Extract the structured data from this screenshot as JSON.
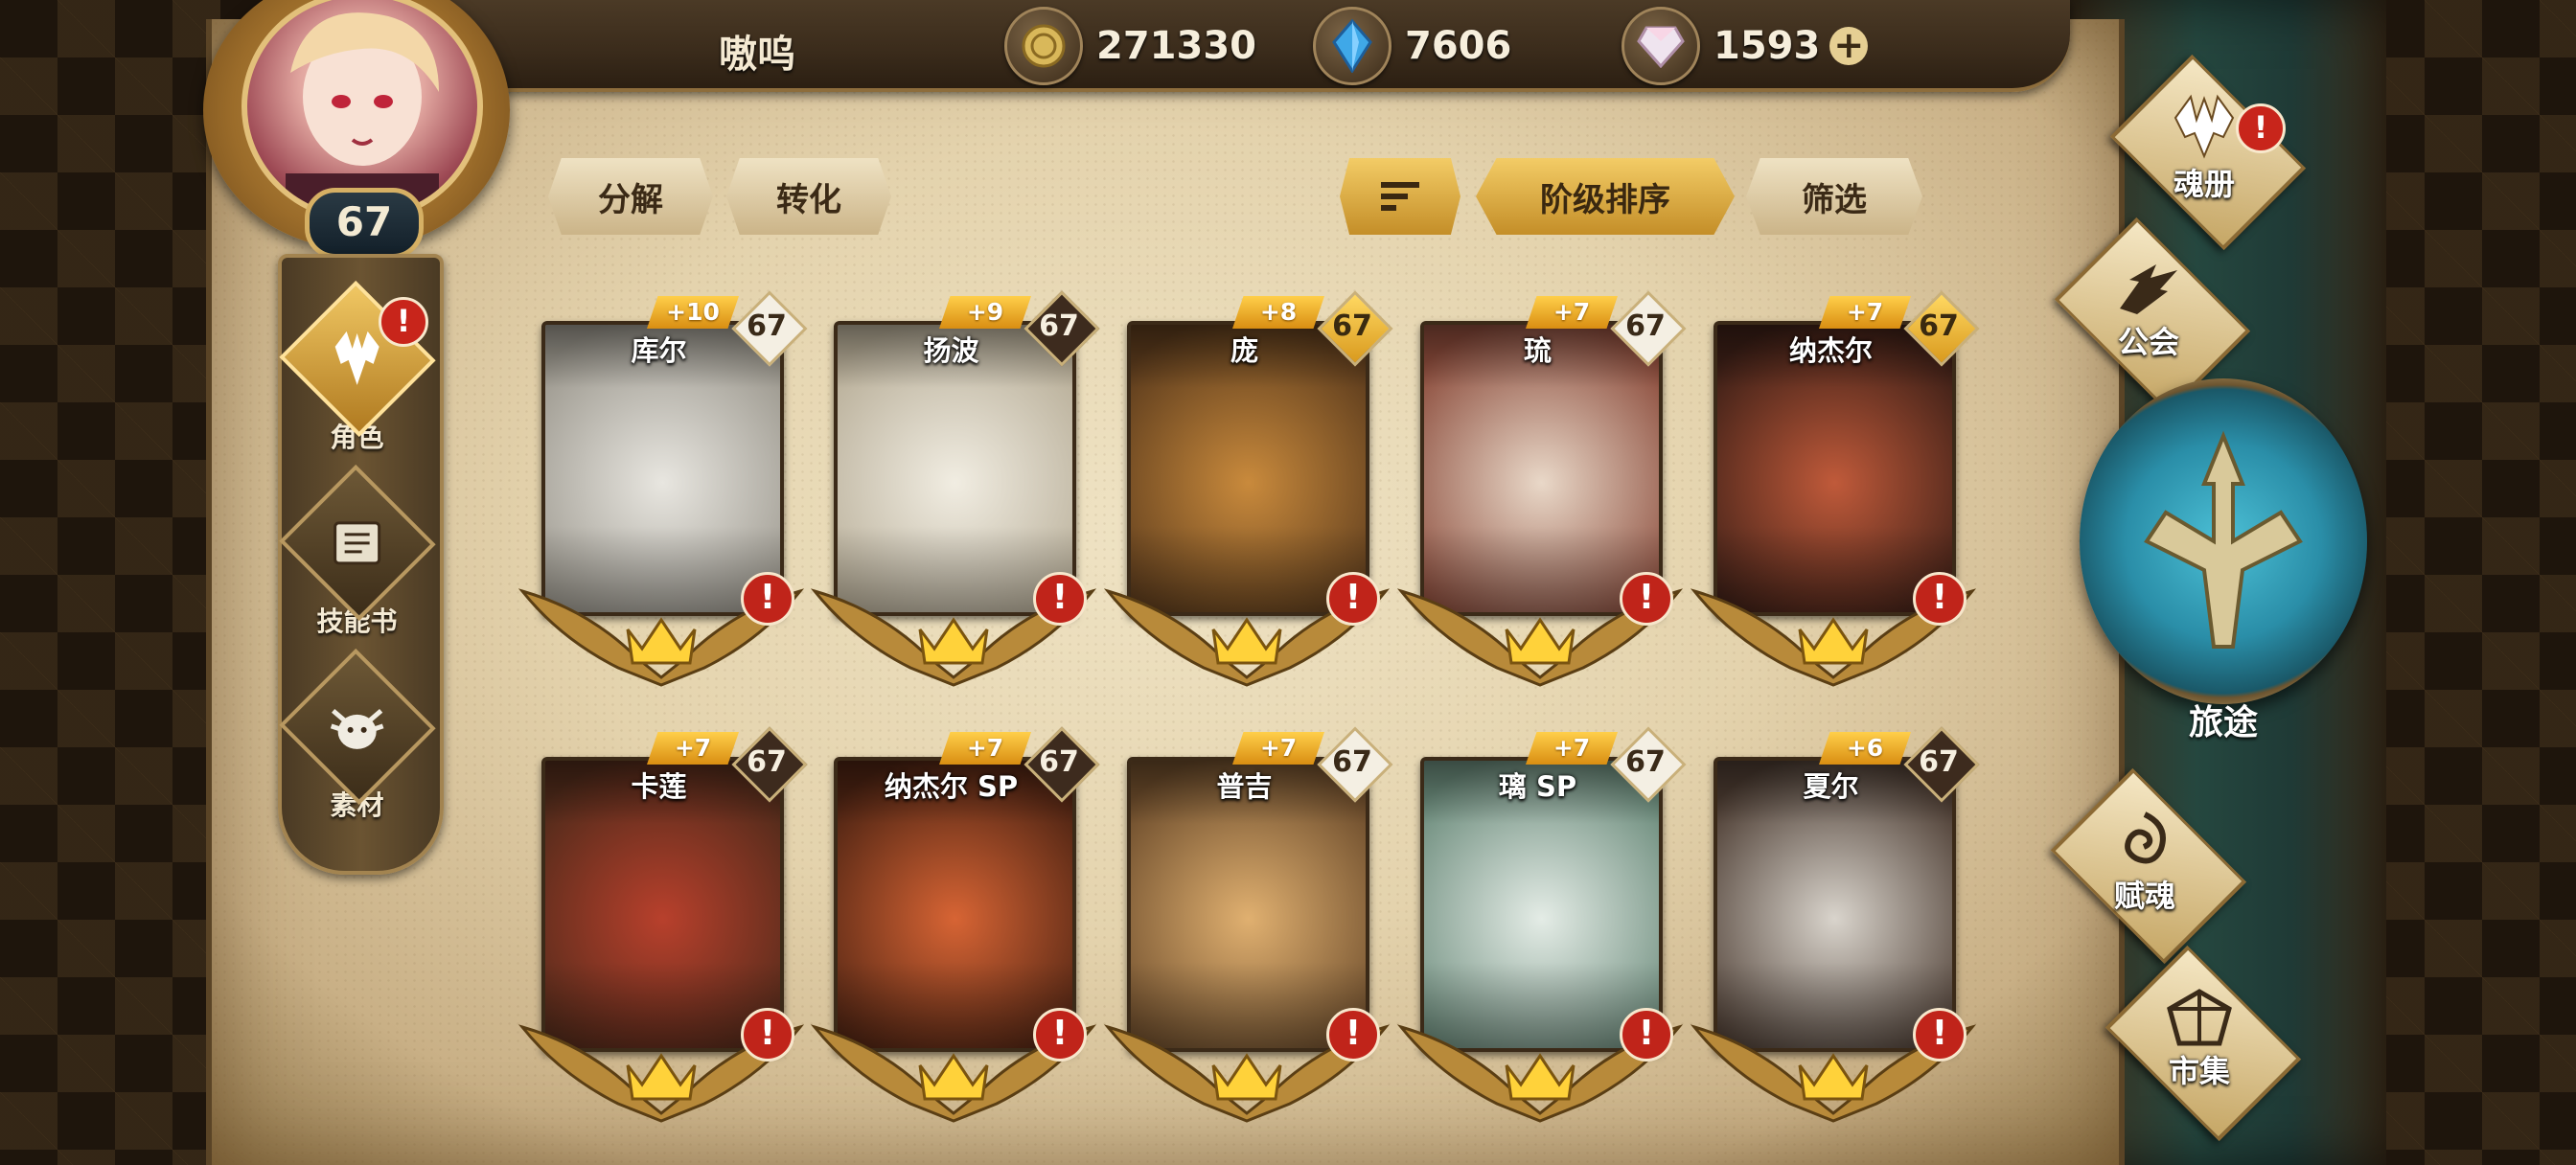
{
  "player": {
    "name": "嗷呜",
    "level": "67"
  },
  "resources": [
    {
      "name": "gold",
      "value": "271330",
      "color": "#e0c16a"
    },
    {
      "name": "crystal",
      "value": "7606",
      "color": "#3fa8e8"
    },
    {
      "name": "gem",
      "value": "1593",
      "color": "#e6d9e6"
    }
  ],
  "left_nav": [
    {
      "label": "角色",
      "icon": "character-icon",
      "active": true,
      "alert": "!"
    },
    {
      "label": "技能书",
      "icon": "skill-book-icon",
      "active": false
    },
    {
      "label": "素材",
      "icon": "material-icon",
      "active": false
    }
  ],
  "actions": {
    "decompose": "分解",
    "convert": "转化",
    "sort_by_tier": "阶级排序",
    "filter": "筛选"
  },
  "cards": [
    {
      "name": "库尔",
      "plus": "+10",
      "level": "67",
      "level_style": "white",
      "art_colors": [
        "#e8e6e0",
        "#9a968c"
      ]
    },
    {
      "name": "扬波",
      "plus": "+9",
      "level": "67",
      "level_style": "dark",
      "art_colors": [
        "#f1ede2",
        "#b7ad97"
      ]
    },
    {
      "name": "庞",
      "plus": "+8",
      "level": "67",
      "level_style": "gold",
      "art_colors": [
        "#c98a3c",
        "#5a3a1c"
      ]
    },
    {
      "name": "琉",
      "plus": "+7",
      "level": "67",
      "level_style": "white",
      "art_colors": [
        "#e9d8c8",
        "#8a4a3a"
      ]
    },
    {
      "name": "纳杰尔",
      "plus": "+7",
      "level": "67",
      "level_style": "gold",
      "art_colors": [
        "#c05a3a",
        "#3a1e16"
      ]
    },
    {
      "name": "卡莲",
      "plus": "+7",
      "level": "67",
      "level_style": "dark",
      "art_colors": [
        "#b8402c",
        "#4e2a1a"
      ]
    },
    {
      "name": "纳杰尔 SP",
      "plus": "+7",
      "level": "67",
      "level_style": "dark",
      "art_colors": [
        "#d76434",
        "#4a2212"
      ]
    },
    {
      "name": "普吉",
      "plus": "+7",
      "level": "67",
      "level_style": "white",
      "art_colors": [
        "#e0b070",
        "#6a4a2a"
      ]
    },
    {
      "name": "璃 SP",
      "plus": "+7",
      "level": "67",
      "level_style": "white",
      "art_colors": [
        "#e4ece6",
        "#6a8a7a"
      ]
    },
    {
      "name": "夏尔",
      "plus": "+6",
      "level": "67",
      "level_style": "dark",
      "art_colors": [
        "#d9d4cc",
        "#4a3a30"
      ]
    }
  ],
  "right_menu": [
    {
      "label": "魂册",
      "icon": "soul-book-icon",
      "alert": "!"
    },
    {
      "label": "公会",
      "icon": "guild-icon"
    },
    {
      "label": "旅途",
      "icon": "journey-icon"
    },
    {
      "label": "赋魂",
      "icon": "soul-infuse-icon"
    },
    {
      "label": "市集",
      "icon": "market-icon"
    }
  ],
  "alert_mark": "!",
  "plus_mark": "+",
  "accent_gold": "#e9b43c",
  "alert_red": "#c0241a"
}
